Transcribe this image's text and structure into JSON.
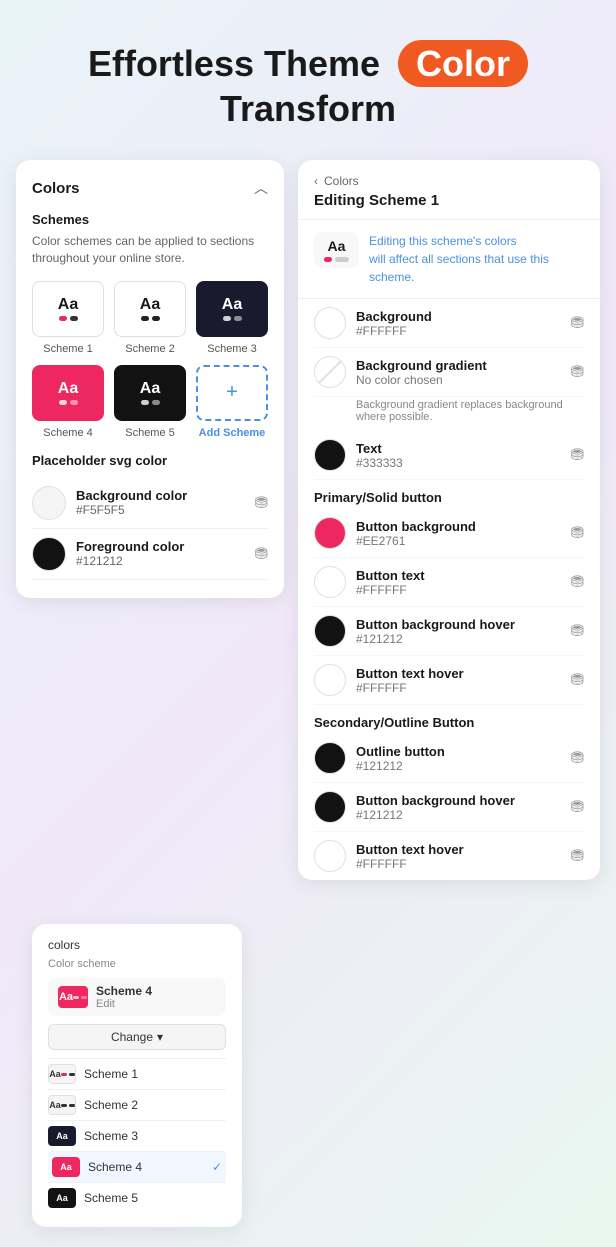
{
  "header": {
    "title_part1": "Effortless Theme",
    "badge": "Color",
    "title_part2": "Transform"
  },
  "left_panel": {
    "title": "Colors",
    "chevron": "^",
    "schemes_label": "Schemes",
    "schemes_desc": "Color schemes can be applied to sections throughout your online store.",
    "schemes": [
      {
        "name": "Scheme 1",
        "type": "light"
      },
      {
        "name": "Scheme 2",
        "type": "light"
      },
      {
        "name": "Scheme 3",
        "type": "dark"
      },
      {
        "name": "Scheme 4",
        "type": "pink"
      },
      {
        "name": "Scheme 5",
        "type": "dark-scheme5"
      },
      {
        "name": "Add Scheme",
        "type": "add"
      }
    ],
    "placeholder_label": "Placeholder svg color",
    "bg_color_label": "Background color",
    "bg_color_value": "#F5F5F5",
    "fg_color_label": "Foreground color",
    "fg_color_value": "#121212"
  },
  "right_panel": {
    "breadcrumb_parent": "Colors",
    "breadcrumb_back": "‹",
    "editing_title": "Editing Scheme 1",
    "info_text": "Editing this scheme's colors will affect all sections that use this scheme.",
    "colors": [
      {
        "name": "Background",
        "value": "#FFFFFF",
        "swatch": "white"
      },
      {
        "name": "Background gradient",
        "value": "No color chosen",
        "swatch": "no-color",
        "note": "Background gradient replaces background where possible."
      },
      {
        "name": "Text",
        "value": "#333333",
        "swatch": "near-black"
      }
    ],
    "primary_label": "Primary/Solid button",
    "primary_colors": [
      {
        "name": "Button background",
        "value": "#EE2761",
        "swatch": "pink"
      },
      {
        "name": "Button text",
        "value": "#FFFFFF",
        "swatch": "white"
      },
      {
        "name": "Button background hover",
        "value": "#121212",
        "swatch": "near-black"
      },
      {
        "name": "Button text hover",
        "value": "#FFFFFF",
        "swatch": "white"
      }
    ],
    "secondary_label": "Secondary/Outline Button",
    "secondary_colors": [
      {
        "name": "Outline button",
        "value": "#121212",
        "swatch": "near-black"
      },
      {
        "name": "Button background hover",
        "value": "#121212",
        "swatch": "near-black"
      },
      {
        "name": "Button text hover",
        "value": "#FFFFFF",
        "swatch": "white"
      }
    ]
  },
  "mini_panel": {
    "title": "colors",
    "label": "Color scheme",
    "selected_scheme": "Scheme 4",
    "edit_label": "Edit",
    "change_btn": "Change",
    "schemes": [
      {
        "name": "Scheme 1",
        "type": "light"
      },
      {
        "name": "Scheme 2",
        "type": "light"
      },
      {
        "name": "Scheme 3",
        "type": "dark"
      },
      {
        "name": "Scheme 4",
        "type": "pink",
        "checked": true
      },
      {
        "name": "Scheme 5",
        "type": "dark2"
      }
    ]
  }
}
